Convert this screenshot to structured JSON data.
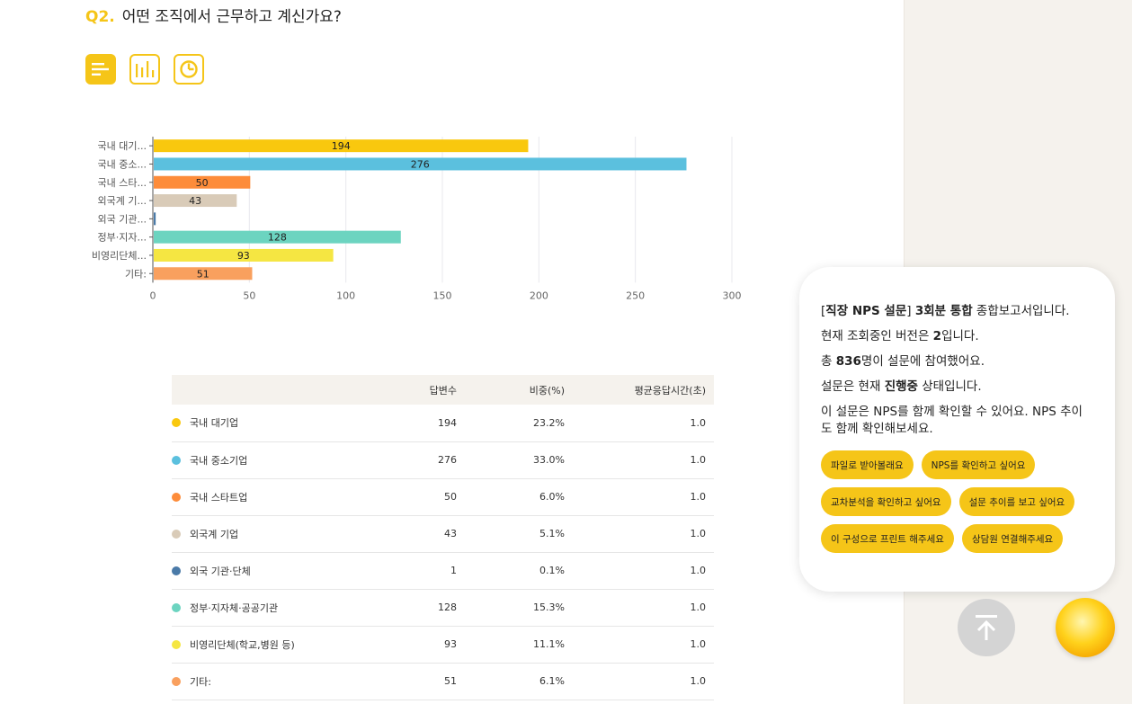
{
  "question": {
    "number": "Q2.",
    "text": "어떤 조직에서 근무하고 계신가요?"
  },
  "view_icons": [
    "list-view-icon",
    "bar-chart-icon",
    "pie-chart-icon"
  ],
  "chart_data": {
    "type": "bar",
    "orientation": "horizontal",
    "categories": [
      "국내 대기...",
      "국내 중소...",
      "국내 스타...",
      "외국계 기...",
      "외국 기관...",
      "정부·지자...",
      "비영리단체...",
      "기타:"
    ],
    "values": [
      194,
      276,
      50,
      43,
      1,
      128,
      93,
      51
    ],
    "colors": [
      "#f9c80e",
      "#5bc0de",
      "#fd8c3a",
      "#d9cbb8",
      "#4a7aa8",
      "#6cd4c0",
      "#f5e642",
      "#f9a05e"
    ],
    "xlim": [
      0,
      300
    ],
    "xticks": [
      0,
      50,
      100,
      150,
      200,
      250,
      300
    ],
    "grid": true
  },
  "table": {
    "headers": [
      "",
      "답변수",
      "비중(%)",
      "평균응답시간(초)"
    ],
    "rows": [
      {
        "name": "국내 대기업",
        "count": "194",
        "ratio": "23.2%",
        "time": "1.0",
        "color": "#f9c80e"
      },
      {
        "name": "국내 중소기업",
        "count": "276",
        "ratio": "33.0%",
        "time": "1.0",
        "color": "#5bc0de"
      },
      {
        "name": "국내 스타트업",
        "count": "50",
        "ratio": "6.0%",
        "time": "1.0",
        "color": "#fd8c3a"
      },
      {
        "name": "외국계 기업",
        "count": "43",
        "ratio": "5.1%",
        "time": "1.0",
        "color": "#d9cbb8"
      },
      {
        "name": "외국 기관·단체",
        "count": "1",
        "ratio": "0.1%",
        "time": "1.0",
        "color": "#4a7aa8"
      },
      {
        "name": "정부·지자체·공공기관",
        "count": "128",
        "ratio": "15.3%",
        "time": "1.0",
        "color": "#6cd4c0"
      },
      {
        "name": "비영리단체(학교,병원 등)",
        "count": "93",
        "ratio": "11.1%",
        "time": "1.0",
        "color": "#f5e642"
      },
      {
        "name": "기타:",
        "count": "51",
        "ratio": "6.1%",
        "time": "1.0",
        "color": "#f9a05e"
      }
    ]
  },
  "info": {
    "line1_pre": "[",
    "line1_survey": "직장 NPS 설문",
    "line1_mid": "] ",
    "line1_rounds": "3회분 통합",
    "line1_post": " 종합보고서입니다.",
    "line2_pre": "현재 조회중인 버전은 ",
    "line2_version": "2",
    "line2_post": "입니다.",
    "line3_pre": "총 ",
    "line3_count": "836",
    "line3_post": "명이 설문에 참여했어요.",
    "line4_pre": "설문은 현재 ",
    "line4_status": "진행중",
    "line4_post": " 상태입니다.",
    "line5": "이 설문은 NPS를 함께 확인할 수 있어요. NPS 추이도 함께 확인해보세요."
  },
  "actions": [
    "파일로 받아볼래요",
    "NPS를 확인하고 싶어요",
    "교차분석을 확인하고 싶어요",
    "설문 추이를 보고 싶어요",
    "이 구성으로 프린트 해주세요",
    "상담원 연결해주세요"
  ]
}
